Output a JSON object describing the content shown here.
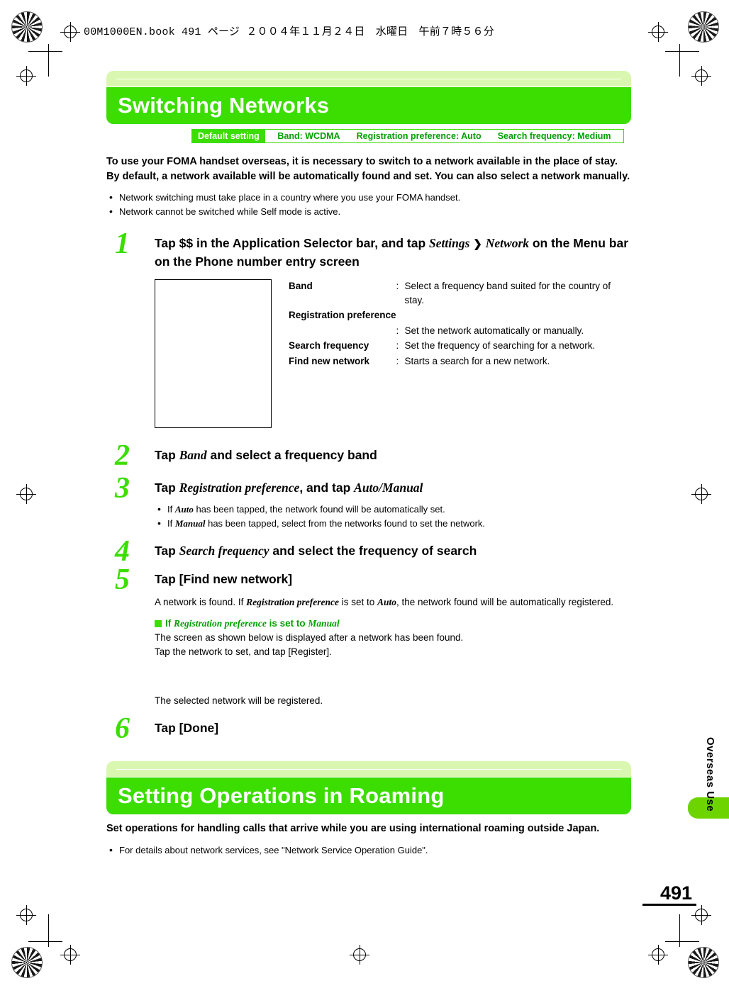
{
  "header_strip": "00M1000EN.book  491 ページ  ２００４年１１月２４日　水曜日　午前７時５６分",
  "sections": [
    {
      "title": "Switching Networks",
      "default_setting": {
        "label": "Default setting",
        "items": [
          "Band: WCDMA",
          "Registration preference: Auto",
          "Search frequency: Medium"
        ]
      },
      "lead": "To use your FOMA handset overseas, it is necessary to switch to a network available in the place of stay. By default, a network available will be automatically found and set. You can also select a network manually.",
      "bullets": [
        "Network switching must take place in a country where you use your FOMA handset.",
        "Network cannot be switched while Self mode is active."
      ],
      "steps": [
        {
          "num": "1",
          "title_html": "Tap $$ in the Application Selector bar, and tap <span class=\"it\">Settings</span> <span class=\"arrow\">❯</span> <span class=\"it\">Network</span> on the Menu bar on the Phone number entry screen"
        },
        {
          "num": "2",
          "title_html": "Tap <span class=\"it\">Band</span> and select a frequency band"
        },
        {
          "num": "3",
          "title_html": "Tap <span class=\"it\">Registration preference</span>, and tap <span class=\"it\">Auto/Manual</span>"
        },
        {
          "num": "4",
          "title_html": "Tap <span class=\"it\">Search frequency</span> and select the frequency of search"
        },
        {
          "num": "5",
          "title_html": "Tap [Find new network]"
        },
        {
          "num": "6",
          "title_html": "Tap [Done]"
        }
      ],
      "descriptions": [
        {
          "term": "Band",
          "colon": ":",
          "def": "Select a frequency band suited for the country of stay."
        },
        {
          "term": "Registration preference",
          "colon": "",
          "def": ""
        },
        {
          "term": "",
          "colon": ":",
          "def": "Set the network automatically or manually."
        },
        {
          "term": "Search frequency",
          "colon": ":",
          "def": "Set the frequency of searching for a network."
        },
        {
          "term": "Find new network",
          "colon": ":",
          "def": "Starts a search for a new network."
        }
      ],
      "step3_bullets_html": [
        "If <span class=\"it\">Auto</span> has been tapped, the network found will be automatically set.",
        "If <span class=\"it\">Manual</span> has been tapped, select from the networks found to set the network."
      ],
      "step5_body_html": "A network is found. If <span class=\"it\">Registration preference</span> is set to <span class=\"it\">Auto</span>, the network found will be automatically registered.",
      "step5_subhead_html": "If <span class=\"ser\">Registration preference</span> is set to <span class=\"ser\">Manual</span>",
      "step5_sub_lines": [
        "The screen as shown below is displayed after a network has been found.",
        "Tap the network to set, and tap [Register]."
      ],
      "step5_after_figure": "The selected network will be registered."
    },
    {
      "title": "Setting Operations in Roaming",
      "lead": "Set operations for handling calls that arrive while you are using international roaming outside Japan.",
      "bullets": [
        "For details about network services, see \"Network Service Operation Guide\"."
      ]
    }
  ],
  "chapter_tab": "Overseas Use",
  "page_number": "491",
  "colors": {
    "green": "#3cdd00",
    "light_green": "#d9f7b0",
    "dark_green": "#00a000"
  }
}
